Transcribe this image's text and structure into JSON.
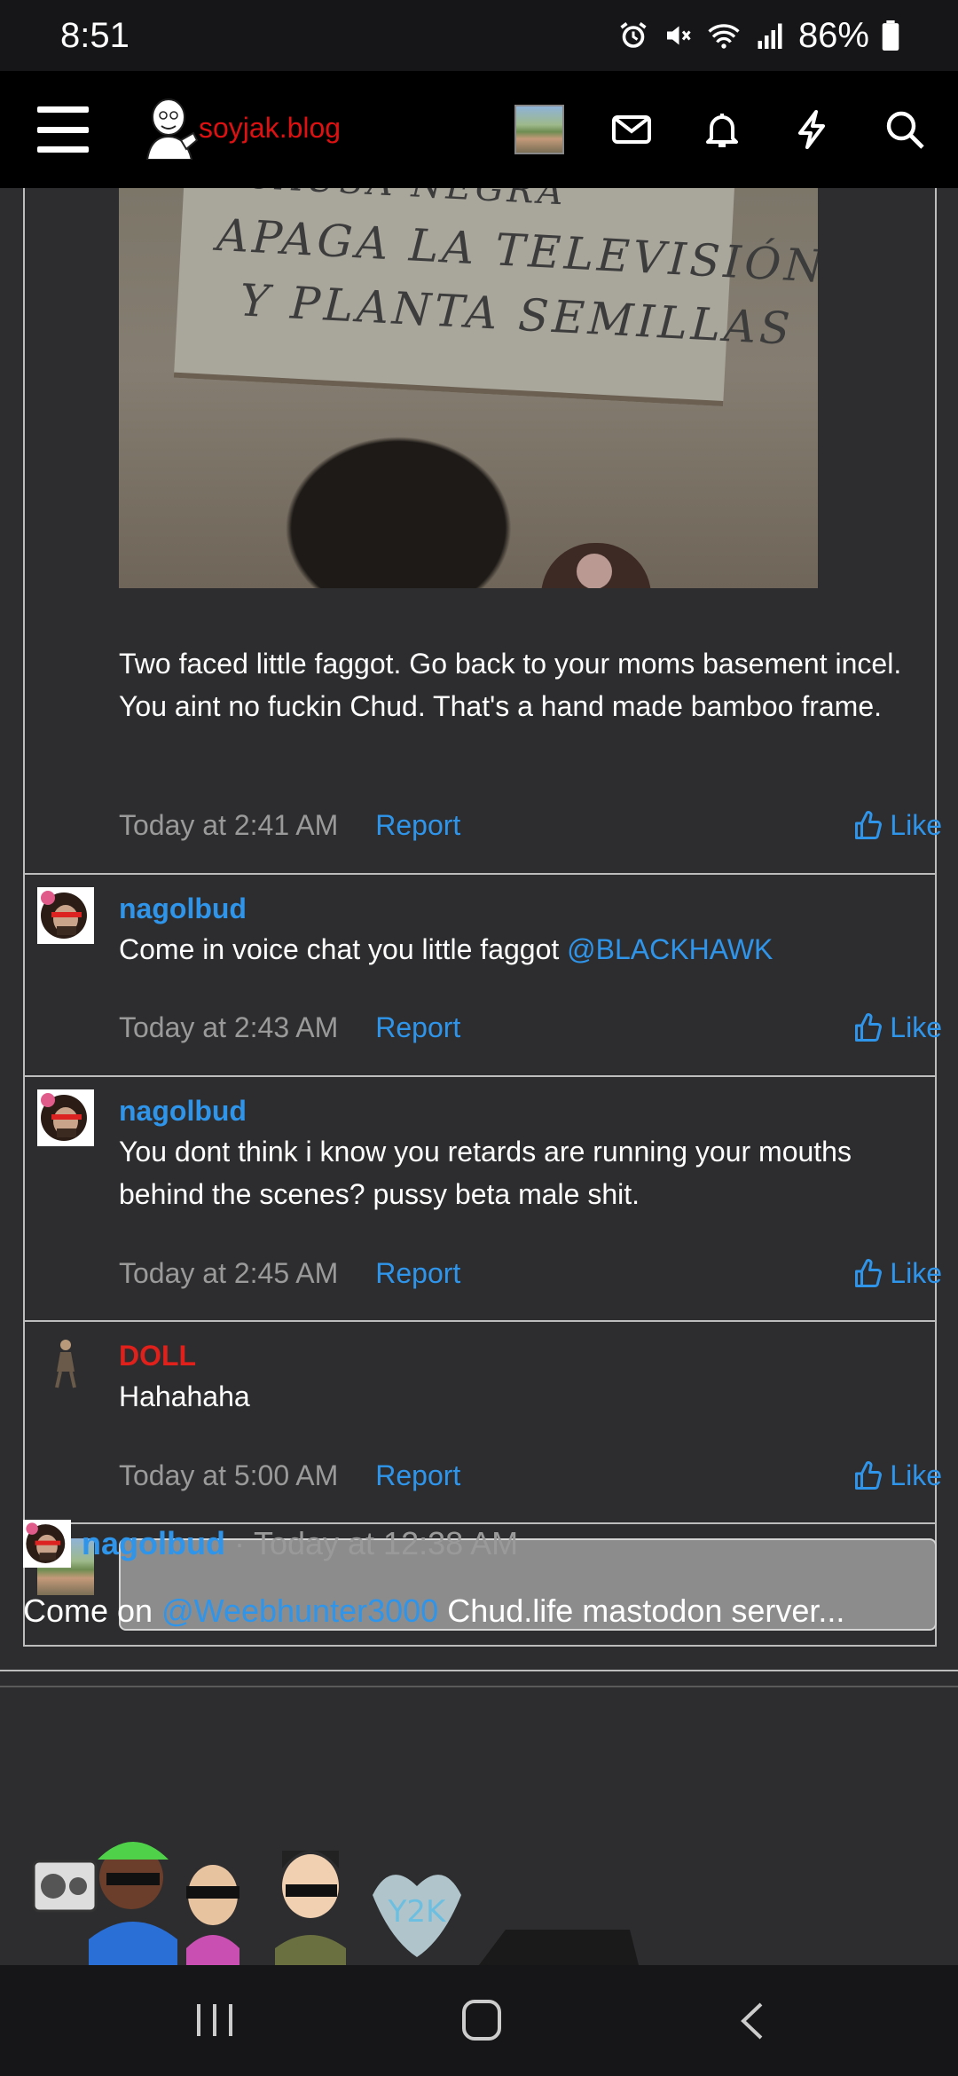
{
  "status": {
    "time": "8:51",
    "battery": "86%"
  },
  "nav": {
    "site_name": "soyjak.blog"
  },
  "image_sign": {
    "line1": "CAUSA NEGRA",
    "line2": "APAGA LA TELEVISIÓN",
    "line3": "Y PLANTA SEMILLAS"
  },
  "first_post": {
    "text": "Two faced little faggot. Go back to your moms basement incel. You aint no fuckin Chud. That's a hand made bamboo frame.",
    "time": "Today at 2:41 AM",
    "report": "Report",
    "like": "Like"
  },
  "comments": [
    {
      "user": "nagolbud",
      "text": "Come in voice chat you little faggot ",
      "mention": "@BLACKHAWK",
      "time": "Today at 2:43 AM",
      "report": "Report",
      "like": "Like"
    },
    {
      "user": "nagolbud",
      "text": "You dont think i know you retards are running your mouths behind the scenes? pussy beta male shit.",
      "time": "Today at 2:45 AM",
      "report": "Report",
      "like": "Like"
    },
    {
      "user": "DOLL",
      "text": "Hahahaha",
      "time": "Today at 5:00 AM",
      "report": "Report",
      "like": "Like"
    }
  ],
  "next_post": {
    "user": "nagolbud",
    "separator": "·",
    "time": "Today at 12:38 AM",
    "text_before": "Come on ",
    "mention": "@Weebhunter3000",
    "text_after": " Chud.life mastodon server...",
    "sticker_text": "Y2K"
  }
}
